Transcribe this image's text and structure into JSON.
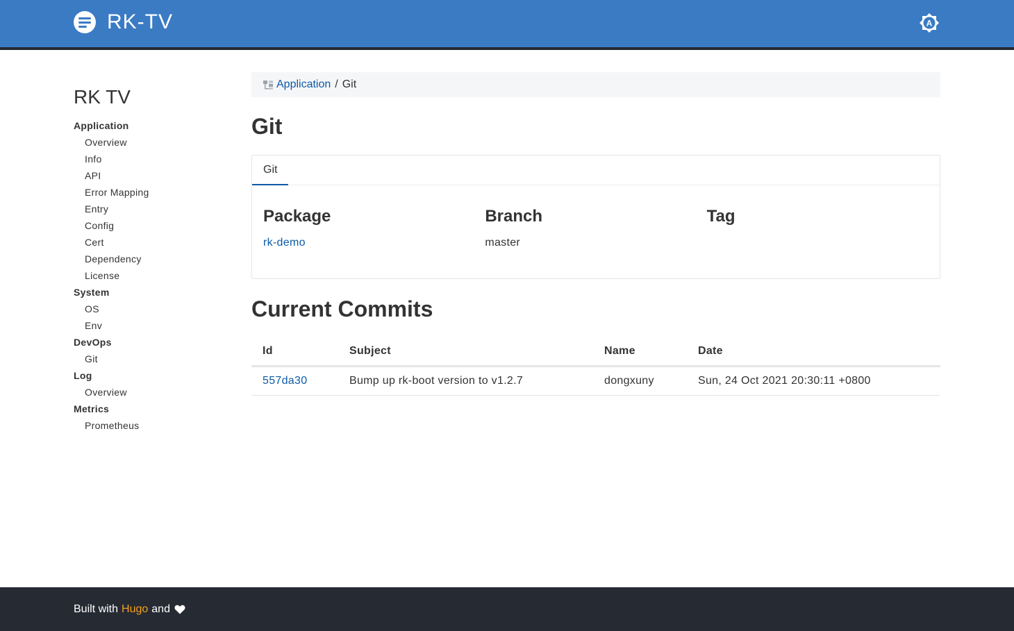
{
  "header": {
    "brand": "RK-TV",
    "logo_icon": "list-lines-icon",
    "theme_icon": "auto-theme-icon",
    "theme_letter": "A",
    "bg_color": "#3a7bc4"
  },
  "sidebar": {
    "title": "RK TV",
    "sections": [
      {
        "title": "Application",
        "items": [
          "Overview",
          "Info",
          "API",
          "Error Mapping",
          "Entry",
          "Config",
          "Cert",
          "Dependency",
          "License"
        ]
      },
      {
        "title": "System",
        "items": [
          "OS",
          "Env"
        ]
      },
      {
        "title": "DevOps",
        "items": [
          "Git"
        ]
      },
      {
        "title": "Log",
        "items": [
          "Overview"
        ]
      },
      {
        "title": "Metrics",
        "items": [
          "Prometheus"
        ]
      }
    ]
  },
  "breadcrumb": {
    "icon": "sitemap-icon",
    "link": "Application",
    "separator": "/",
    "current": "Git"
  },
  "page": {
    "title": "Git"
  },
  "git_panel": {
    "tab": "Git",
    "columns": [
      {
        "heading": "Package",
        "value": "rk-demo",
        "is_link": true
      },
      {
        "heading": "Branch",
        "value": "master",
        "is_link": false
      },
      {
        "heading": "Tag",
        "value": "",
        "is_link": false
      }
    ]
  },
  "commits": {
    "title": "Current Commits",
    "headers": [
      "Id",
      "Subject",
      "Name",
      "Date"
    ],
    "rows": [
      {
        "id": "557da30",
        "subject": "Bump up rk-boot version to v1.2.7",
        "name": "dongxuny",
        "date": "Sun, 24 Oct 2021 20:30:11 +0800"
      }
    ]
  },
  "footer": {
    "prefix": "Built with",
    "link": "Hugo",
    "suffix": "and",
    "icon": "heart-icon",
    "link_color": "#f4a11a"
  }
}
